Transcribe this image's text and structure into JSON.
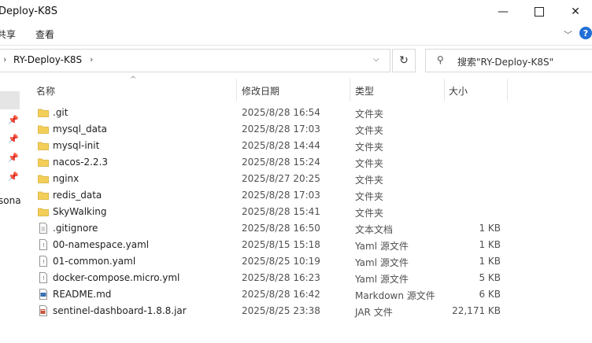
{
  "window": {
    "title": "Deploy-K8S",
    "min_glyph": "—",
    "close_glyph": "✕"
  },
  "ribbon": {
    "share_tab": "共享",
    "view_tab": "查看",
    "expand_glyph": "﹀",
    "help_glyph": "?"
  },
  "address": {
    "path": "RY-Deploy-K8S",
    "chevron": "›",
    "dropdown": "⌵",
    "refresh_glyph": "↻"
  },
  "search": {
    "placeholder": "搜索\"RY-Deploy-K8S\"",
    "icon": "⚲"
  },
  "nav": {
    "partial_label": "sona",
    "pin_glyph": "📌"
  },
  "columns": {
    "name": "名称",
    "date": "修改日期",
    "type": "类型",
    "size": "大小",
    "sort_glyph": "^"
  },
  "files": [
    {
      "name": ".git",
      "date": "2025/8/28 16:54",
      "type": "文件夹",
      "size": "",
      "icon": "folder-icon"
    },
    {
      "name": "mysql_data",
      "date": "2025/8/28 17:03",
      "type": "文件夹",
      "size": "",
      "icon": "folder-icon"
    },
    {
      "name": "mysql-init",
      "date": "2025/8/28 14:44",
      "type": "文件夹",
      "size": "",
      "icon": "folder-icon"
    },
    {
      "name": "nacos-2.2.3",
      "date": "2025/8/28 15:24",
      "type": "文件夹",
      "size": "",
      "icon": "folder-icon"
    },
    {
      "name": "nginx",
      "date": "2025/8/27 20:25",
      "type": "文件夹",
      "size": "",
      "icon": "folder-icon"
    },
    {
      "name": "redis_data",
      "date": "2025/8/28 17:03",
      "type": "文件夹",
      "size": "",
      "icon": "folder-icon"
    },
    {
      "name": "SkyWalking",
      "date": "2025/8/28 15:41",
      "type": "文件夹",
      "size": "",
      "icon": "folder-icon"
    },
    {
      "name": ".gitignore",
      "date": "2025/8/28 16:50",
      "type": "文本文档",
      "size": "1 KB",
      "icon": "text-file-icon"
    },
    {
      "name": "00-namespace.yaml",
      "date": "2025/8/15 15:18",
      "type": "Yaml 源文件",
      "size": "1 KB",
      "icon": "yaml-file-icon"
    },
    {
      "name": "01-common.yaml",
      "date": "2025/8/25 10:19",
      "type": "Yaml 源文件",
      "size": "1 KB",
      "icon": "yaml-file-icon"
    },
    {
      "name": "docker-compose.micro.yml",
      "date": "2025/8/28 16:23",
      "type": "Yaml 源文件",
      "size": "5 KB",
      "icon": "yaml-file-icon"
    },
    {
      "name": "README.md",
      "date": "2025/8/28 16:42",
      "type": "Markdown 源文件",
      "size": "6 KB",
      "icon": "markdown-file-icon"
    },
    {
      "name": "sentinel-dashboard-1.8.8.jar",
      "date": "2025/8/25 23:38",
      "type": "JAR 文件",
      "size": "22,171 KB",
      "icon": "jar-file-icon"
    }
  ],
  "colors": {
    "folder": "#f3cf5a",
    "accent": "#1f6fd6",
    "selection": "#e5e5e5"
  }
}
